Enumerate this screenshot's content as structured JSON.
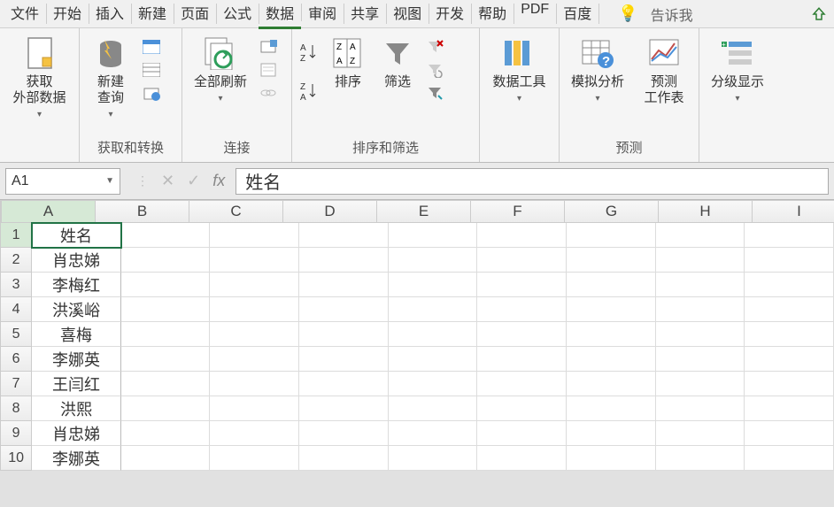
{
  "menu": {
    "items": [
      "文件",
      "开始",
      "插入",
      "新建",
      "页面",
      "公式",
      "数据",
      "审阅",
      "共享",
      "视图",
      "开发",
      "帮助",
      "PDF",
      "百度"
    ],
    "active_index": 6,
    "tell_me": "告诉我"
  },
  "ribbon": {
    "groups": [
      {
        "label": "",
        "buttons": [
          {
            "label": "获取\n外部数据"
          }
        ]
      },
      {
        "label": "获取和转换",
        "buttons": [
          {
            "label": "新建\n查询"
          }
        ]
      },
      {
        "label": "连接",
        "buttons": [
          {
            "label": "全部刷新"
          }
        ]
      },
      {
        "label": "排序和筛选",
        "buttons": [
          {
            "label": "排序"
          },
          {
            "label": "筛选"
          }
        ]
      },
      {
        "label": "",
        "buttons": [
          {
            "label": "数据工具"
          }
        ]
      },
      {
        "label": "预测",
        "buttons": [
          {
            "label": "模拟分析"
          },
          {
            "label": "预测\n工作表"
          }
        ]
      },
      {
        "label": "",
        "buttons": [
          {
            "label": "分级显示"
          }
        ]
      }
    ]
  },
  "formula_bar": {
    "name_box": "A1",
    "formula": "姓名"
  },
  "grid": {
    "columns": [
      "A",
      "B",
      "C",
      "D",
      "E",
      "F",
      "G",
      "H",
      "I"
    ],
    "selected_col": 0,
    "selected_row": 0,
    "rows": [
      {
        "num": 1,
        "cells": [
          "姓名",
          "",
          "",
          "",
          "",
          "",
          "",
          "",
          ""
        ]
      },
      {
        "num": 2,
        "cells": [
          "肖忠娣",
          "",
          "",
          "",
          "",
          "",
          "",
          "",
          ""
        ]
      },
      {
        "num": 3,
        "cells": [
          "李梅红",
          "",
          "",
          "",
          "",
          "",
          "",
          "",
          ""
        ]
      },
      {
        "num": 4,
        "cells": [
          "洪溪峪",
          "",
          "",
          "",
          "",
          "",
          "",
          "",
          ""
        ]
      },
      {
        "num": 5,
        "cells": [
          "喜梅",
          "",
          "",
          "",
          "",
          "",
          "",
          "",
          ""
        ]
      },
      {
        "num": 6,
        "cells": [
          "李娜英",
          "",
          "",
          "",
          "",
          "",
          "",
          "",
          ""
        ]
      },
      {
        "num": 7,
        "cells": [
          "王闫红",
          "",
          "",
          "",
          "",
          "",
          "",
          "",
          ""
        ]
      },
      {
        "num": 8,
        "cells": [
          "洪熙",
          "",
          "",
          "",
          "",
          "",
          "",
          "",
          ""
        ]
      },
      {
        "num": 9,
        "cells": [
          "肖忠娣",
          "",
          "",
          "",
          "",
          "",
          "",
          "",
          ""
        ]
      },
      {
        "num": 10,
        "cells": [
          "李娜英",
          "",
          "",
          "",
          "",
          "",
          "",
          "",
          ""
        ]
      }
    ]
  }
}
